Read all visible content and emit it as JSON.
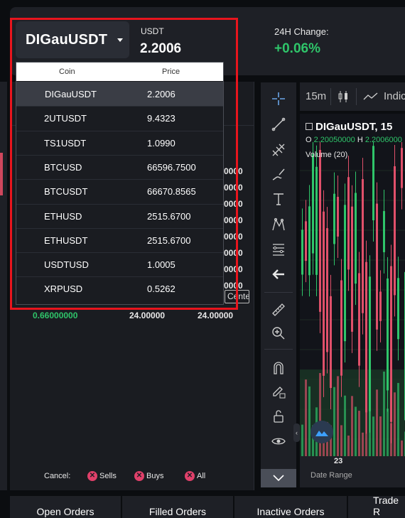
{
  "header": {
    "pair": "DIGauUSDT",
    "quote_label": "USDT",
    "quote_price": "2.2006",
    "change_label": "24H Change:",
    "change_value": "+0.06%"
  },
  "dropdown": {
    "col_coin": "Coin",
    "col_price": "Price",
    "rows": [
      {
        "coin": "DIGauUSDT",
        "price": "2.2006",
        "selected": true
      },
      {
        "coin": "2UTUSDT",
        "price": "9.4323"
      },
      {
        "coin": "TS1USDT",
        "price": "1.0990"
      },
      {
        "coin": "BTCUSD",
        "price": "66596.7500"
      },
      {
        "coin": "BTCUSDT",
        "price": "66670.8565"
      },
      {
        "coin": "ETHUSD",
        "price": "2515.6700"
      },
      {
        "coin": "ETHUSDT",
        "price": "2515.6700"
      },
      {
        "coin": "USDTUSD",
        "price": "1.0005"
      },
      {
        "coin": "XRPUSD",
        "price": "0.5262"
      }
    ]
  },
  "order_book": {
    "partial_values": [
      "0000",
      "0000",
      "0000",
      "0000",
      "0000",
      "0000",
      "0000",
      "0000"
    ],
    "center_label": "Center",
    "bottom_row": {
      "price": "0.66000000",
      "amount": "24.00000",
      "total": "24.00000"
    }
  },
  "cancel_bar": {
    "label": "Cancel:",
    "sells": "Sells",
    "buys": "Buys",
    "all": "All"
  },
  "chart": {
    "timeframe": "15m",
    "indicators_label": "Indic",
    "title": "DIGauUSDT, 15",
    "ohlc_o_label": "O",
    "ohlc_o_value": "2.20050000",
    "ohlc_h_label": "H",
    "ohlc_h_value": "2.2006000",
    "volume_label": "Volume (20)",
    "date_tick": "23",
    "date_range_label": "Date Range",
    "colors": {
      "up": "#2fc56a",
      "down": "#e0506a"
    }
  },
  "bottom_tabs": [
    "Open Orders",
    "Filled Orders",
    "Inactive Orders",
    "Trade R"
  ],
  "tools": [
    "crosshair-icon",
    "trend-line-icon",
    "pitchfork-icon",
    "brush-icon",
    "text-icon",
    "pattern-icon",
    "fib-icon",
    "back-arrow-icon",
    "ruler-icon",
    "zoom-in-icon",
    "magnet-icon",
    "lock-pencil-icon",
    "unlock-icon",
    "eye-icon"
  ]
}
